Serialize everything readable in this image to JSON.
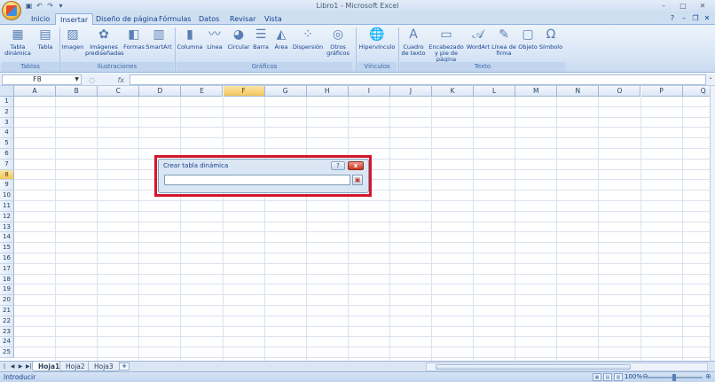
{
  "window": {
    "title": "Libro1 - Microsoft Excel"
  },
  "quick_access": [
    "save-icon",
    "undo-icon",
    "redo-icon",
    "customize-icon"
  ],
  "tabs": [
    {
      "label": "Inicio"
    },
    {
      "label": "Insertar"
    },
    {
      "label": "Diseño de página"
    },
    {
      "label": "Fórmulas"
    },
    {
      "label": "Datos"
    },
    {
      "label": "Revisar"
    },
    {
      "label": "Vista"
    }
  ],
  "active_tab": "Insertar",
  "ribbon": {
    "tablas": {
      "label": "Tablas",
      "items": [
        {
          "label": "Tabla dinámica"
        },
        {
          "label": "Tabla"
        }
      ]
    },
    "ilustraciones": {
      "label": "Ilustraciones",
      "items": [
        {
          "label": "Imagen"
        },
        {
          "label": "Imágenes prediseñadas"
        },
        {
          "label": "Formas"
        },
        {
          "label": "SmartArt"
        }
      ]
    },
    "graficos": {
      "label": "Gráficos",
      "items": [
        {
          "label": "Columna"
        },
        {
          "label": "Línea"
        },
        {
          "label": "Circular"
        },
        {
          "label": "Barra"
        },
        {
          "label": "Área"
        },
        {
          "label": "Dispersión"
        },
        {
          "label": "Otros gráficos"
        }
      ]
    },
    "vinculos": {
      "label": "Vínculos",
      "items": [
        {
          "label": "Hipervínculo"
        }
      ]
    },
    "texto": {
      "label": "Texto",
      "items": [
        {
          "label": "Cuadro de texto"
        },
        {
          "label": "Encabezado y pie de página"
        },
        {
          "label": "WordArt"
        },
        {
          "label": "Línea de firma"
        },
        {
          "label": "Objeto"
        },
        {
          "label": "Símbolo"
        }
      ]
    }
  },
  "formula_bar": {
    "name_box": "F8",
    "fx": "fx",
    "value": ""
  },
  "columns": [
    "A",
    "B",
    "C",
    "D",
    "E",
    "F",
    "G",
    "H",
    "I",
    "J",
    "K",
    "L",
    "M",
    "N",
    "O",
    "P",
    "Q"
  ],
  "rows": [
    "1",
    "2",
    "3",
    "4",
    "5",
    "6",
    "7",
    "8",
    "9",
    "10",
    "11",
    "12",
    "13",
    "14",
    "15",
    "16",
    "17",
    "18",
    "19",
    "20",
    "21",
    "22",
    "23",
    "24",
    "25"
  ],
  "selected_cell": {
    "column": "F",
    "row": "8"
  },
  "dialog": {
    "title": "Crear tabla dinámica",
    "help": "?",
    "close": "x",
    "input_value": ""
  },
  "sheets": [
    {
      "label": "Hoja1"
    },
    {
      "label": "Hoja2"
    },
    {
      "label": "Hoja3"
    }
  ],
  "active_sheet": "Hoja1",
  "status": {
    "text": "Introducir",
    "zoom": "100%"
  },
  "colors": {
    "highlight": "#d5172b",
    "accent": "#15428b",
    "selected_header": "#f4c65a"
  }
}
